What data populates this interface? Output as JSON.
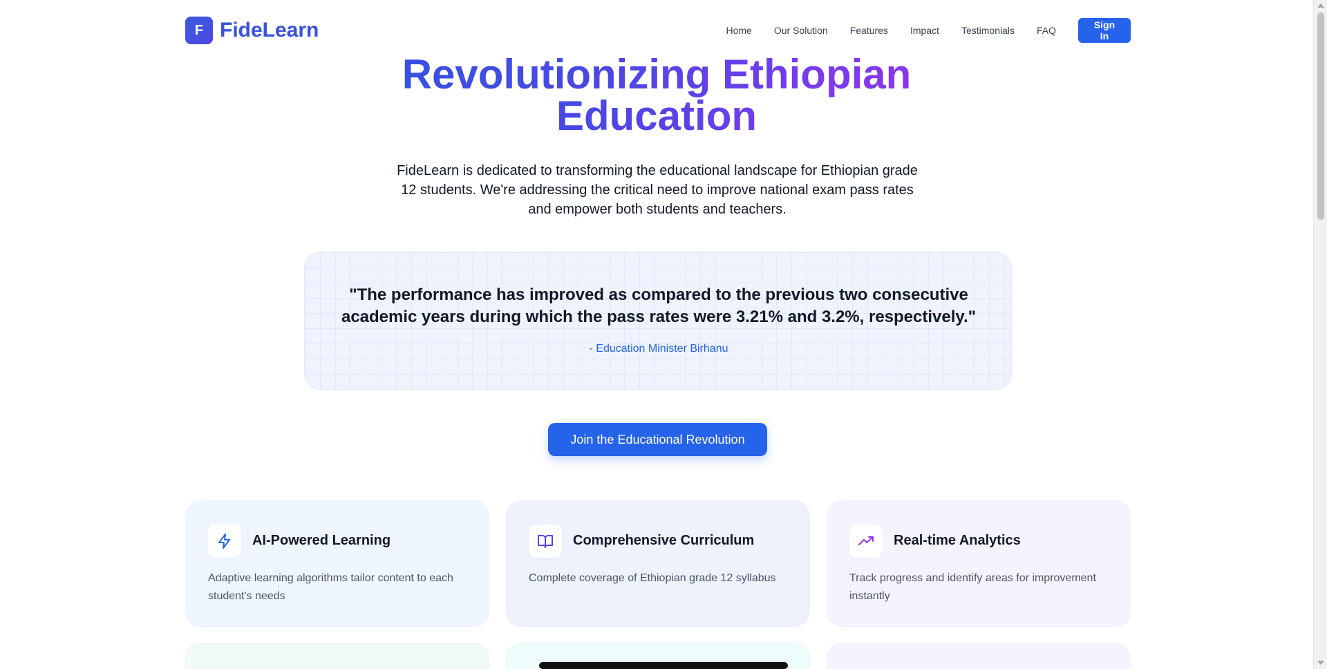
{
  "header": {
    "logo_letter": "F",
    "brand": "FideLearn",
    "nav": [
      "Home",
      "Our Solution",
      "Features",
      "Impact",
      "Testimonials",
      "FAQ"
    ],
    "sign_in": "Sign In"
  },
  "hero": {
    "title": "Revolutionizing Ethiopian Education",
    "subtitle": "FideLearn is dedicated to transforming the educational landscape for Ethiopian grade 12 students. We're addressing the critical need to improve national exam pass rates and empower both students and teachers."
  },
  "quote": {
    "text": "\"The performance has improved as compared to the previous two consecutive academic years during which the pass rates were 3.21% and 3.2%, respectively.\"",
    "author": "- Education Minister Birhanu"
  },
  "cta": {
    "label": "Join the Educational Revolution"
  },
  "features": [
    {
      "icon": "lightning-icon",
      "title": "AI-Powered Learning",
      "desc": "Adaptive learning algorithms tailor content to each student's needs"
    },
    {
      "icon": "book-icon",
      "title": "Comprehensive Curriculum",
      "desc": "Complete coverage of Ethiopian grade 12 syllabus"
    },
    {
      "icon": "trending-up-icon",
      "title": "Real-time Analytics",
      "desc": "Track progress and identify areas for improvement instantly"
    }
  ],
  "colors": {
    "primary": "#2563eb",
    "gradient_start": "#2d55e0",
    "gradient_end": "#9333ea",
    "icon_blue": "#2563eb",
    "icon_indigo": "#4f46e5",
    "icon_purple": "#9333ea"
  }
}
